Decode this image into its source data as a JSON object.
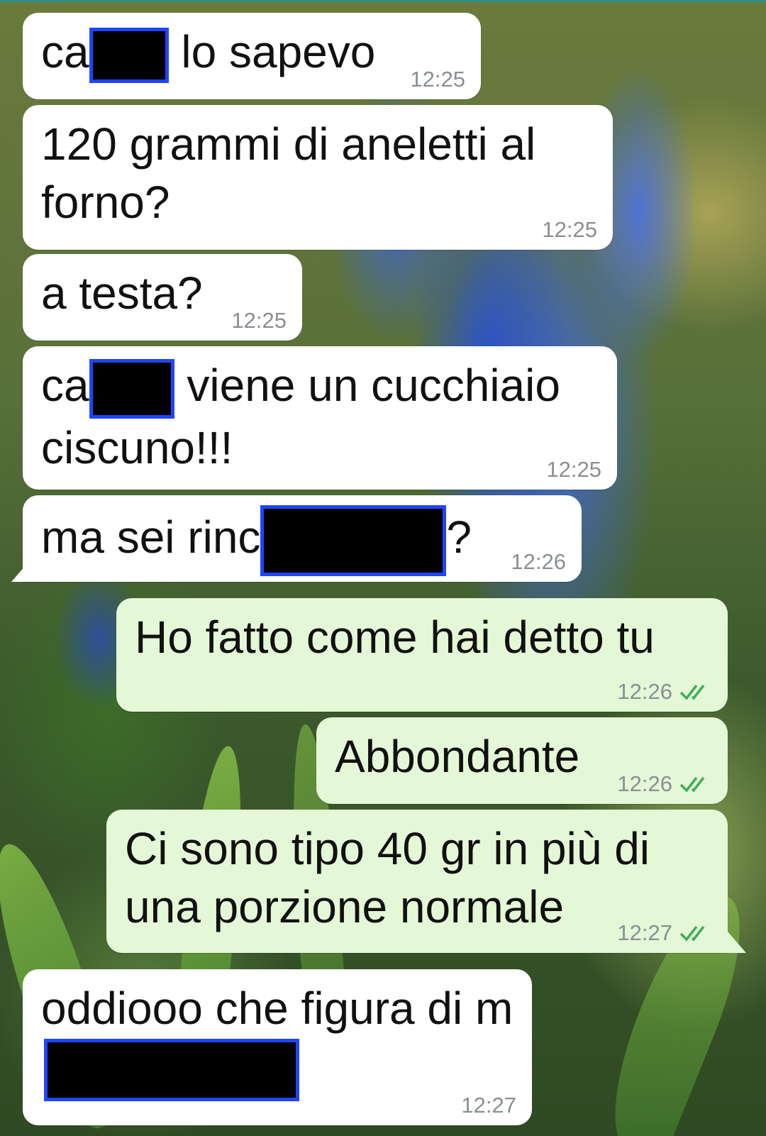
{
  "colors": {
    "incoming_bubble": "#ffffff",
    "outgoing_bubble": "#e4f7d6",
    "read_ticks": "#3fae5a",
    "redaction_fill": "#000000",
    "redaction_border": "#1f45ff"
  },
  "icons": {
    "read_receipt": "double-check-icon",
    "redaction": "redaction-box"
  },
  "messages": [
    {
      "direction": "incoming",
      "before": "ca",
      "after": " lo sapevo",
      "time": "12:25"
    },
    {
      "direction": "incoming",
      "text": "120 grammi di aneletti al forno?",
      "time": "12:25"
    },
    {
      "direction": "incoming",
      "text": "a testa?",
      "time": "12:25"
    },
    {
      "direction": "incoming",
      "before": "ca",
      "after": " viene un cucchiaio ciscuno!!!",
      "time": "12:25"
    },
    {
      "direction": "incoming",
      "before": "ma sei rinc",
      "after": "?",
      "time": "12:26"
    },
    {
      "direction": "outgoing",
      "text": "Ho fatto come hai detto tu",
      "time": "12:26",
      "status": "read"
    },
    {
      "direction": "outgoing",
      "text": "Abbondante",
      "time": "12:26",
      "status": "read"
    },
    {
      "direction": "outgoing",
      "text": "Ci sono tipo 40 gr in più di una porzione normale",
      "time": "12:27",
      "status": "read"
    },
    {
      "direction": "incoming",
      "before": "oddiooo che figura di m",
      "after": "",
      "time": "12:27"
    }
  ]
}
